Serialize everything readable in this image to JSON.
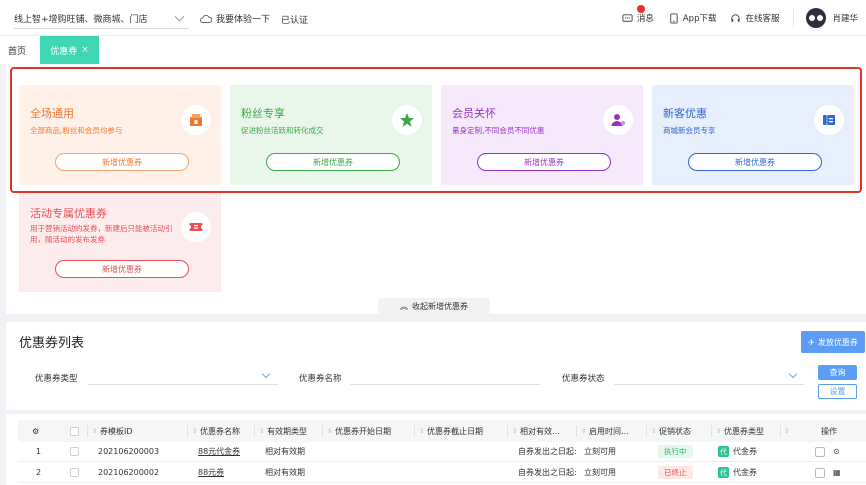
{
  "topbar": {
    "store_select": "线上智+增购旺铺、微商城、门店",
    "try_label": "我要体验一下",
    "verified_label": "已认证",
    "messages_label": "消息",
    "app_download_label": "App下载",
    "support_label": "在线客服",
    "user_name": "肖建华"
  },
  "tabs": {
    "home_label": "首页",
    "active_label": "优惠券",
    "close_glyph": "×"
  },
  "cards": [
    {
      "title": "全场通用",
      "desc": "全部商品,粉丝和会员均参与",
      "button": "新增优惠券",
      "icon": "shop-icon"
    },
    {
      "title": "粉丝专享",
      "desc": "促进粉丝活跃和转化成交",
      "button": "新增优惠券",
      "icon": "star-icon"
    },
    {
      "title": "会员关怀",
      "desc": "量身定制,不同会员不同优惠",
      "button": "新增优惠券",
      "icon": "member-icon"
    },
    {
      "title": "新客优惠",
      "desc": "商城新会员专享",
      "button": "新增优惠券",
      "icon": "ticket-icon"
    },
    {
      "title": "活动专属优惠券",
      "desc": "用于营销活动的发券，新建后只能被活动引用，随活动的发布发券",
      "button": "新增优惠券",
      "icon": "coupon-icon"
    }
  ],
  "collapse_label": "收起新增优惠券",
  "list": {
    "title": "优惠券列表",
    "issue_button": "发放优惠券",
    "filter_type_label": "优惠券类型",
    "filter_name_label": "优惠券名称",
    "filter_status_label": "优惠券状态",
    "query_button": "查询",
    "reset_button": "设置"
  },
  "table": {
    "headers": [
      "券模板ID",
      "优惠券名称",
      "有效期类型",
      "优惠券开始日期",
      "优惠券截止日期",
      "相对有效...",
      "启用时间...",
      "促销状态",
      "优惠券类型",
      "操作"
    ],
    "rows": [
      {
        "no": "1",
        "id": "202106200003",
        "name": "88元代金券",
        "validity": "相对有效期",
        "start": "",
        "end": "",
        "relative": "自券发出之日起:",
        "enable": "立刻可用",
        "status": "执行中",
        "type_tag": "代",
        "type": "代金券"
      },
      {
        "no": "2",
        "id": "202106200002",
        "name": "88元券",
        "validity": "相对有效期",
        "start": "",
        "end": "",
        "relative": "自券发出之日起:",
        "enable": "立刻可用",
        "status": "已终止",
        "type_tag": "代",
        "type": "代金券"
      }
    ]
  },
  "colors": {
    "accent": "#3fd6b4",
    "primary_blue": "#5b9cf5",
    "highlight_red": "#e03526"
  }
}
